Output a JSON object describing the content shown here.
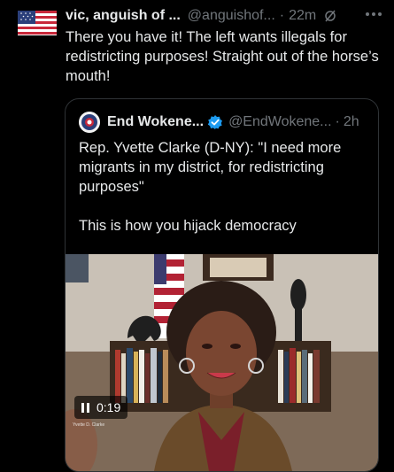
{
  "tweet": {
    "display_name": "vic, anguish of ...",
    "handle": "@anguishof...",
    "separator": "·",
    "time": "22m",
    "text": "There you have it! The left wants illegals for redistricting purposes! Straight out of the horse’s mouth!"
  },
  "quote": {
    "display_name": "End Wokene...",
    "handle": "@EndWokene...",
    "separator": "·",
    "time": "2h",
    "text": "Rep. Yvette Clarke (D-NY): \"I need more migrants in my district, for redistricting purposes\"\n\nThis is how you hijack democracy",
    "video": {
      "state": "paused",
      "duration": "0:19",
      "lower_third": "Yvette D. Clarke"
    }
  },
  "icons": {
    "avatar": "us-flag-icon",
    "grok": "grok-icon",
    "more": "more-icon",
    "verified": "verified-badge-icon",
    "pause": "pause-icon"
  },
  "colors": {
    "background": "#000000",
    "text_primary": "#e7e9ea",
    "text_secondary": "#71767b",
    "border": "#2f3336",
    "verified": "#1d9bf0"
  }
}
